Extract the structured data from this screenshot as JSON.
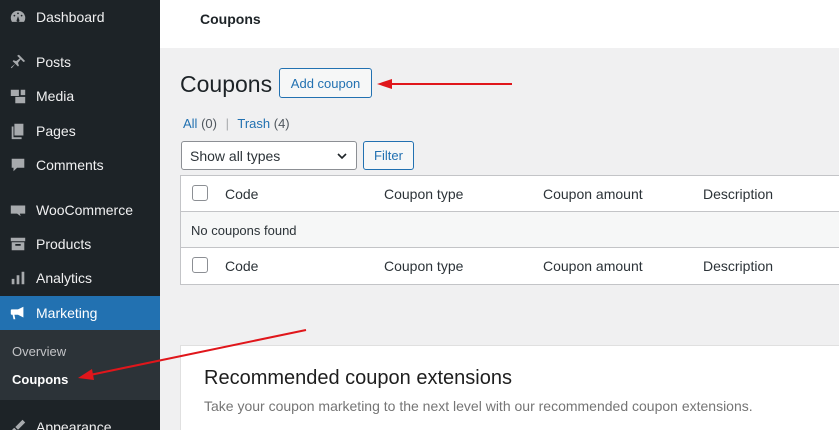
{
  "sidebar": {
    "items": [
      {
        "label": "Dashboard",
        "icon": "dashboard-icon"
      },
      {
        "label": "Posts",
        "icon": "pushpin-icon"
      },
      {
        "label": "Media",
        "icon": "media-icon"
      },
      {
        "label": "Pages",
        "icon": "pages-icon"
      },
      {
        "label": "Comments",
        "icon": "comment-icon"
      },
      {
        "label": "WooCommerce",
        "icon": "woocommerce-icon"
      },
      {
        "label": "Products",
        "icon": "archive-icon"
      },
      {
        "label": "Analytics",
        "icon": "bar-chart-icon"
      },
      {
        "label": "Marketing",
        "icon": "megaphone-icon"
      },
      {
        "label": "Appearance",
        "icon": "paintbrush-icon"
      }
    ],
    "submenu": [
      {
        "label": "Overview"
      },
      {
        "label": "Coupons"
      }
    ]
  },
  "header": {
    "title": "Coupons"
  },
  "main": {
    "title": "Coupons",
    "add_button": "Add coupon",
    "views": {
      "all_label": "All",
      "all_count": "(0)",
      "separator": "|",
      "trash_label": "Trash",
      "trash_count": "(4)"
    },
    "filter": {
      "select_value": "Show all types",
      "button": "Filter"
    },
    "table": {
      "columns": [
        "Code",
        "Coupon type",
        "Coupon amount",
        "Description"
      ],
      "empty_message": "No coupons found"
    },
    "recommended": {
      "title": "Recommended coupon extensions",
      "description": "Take your coupon marketing to the next level with our recommended coupon extensions."
    }
  },
  "colors": {
    "sidebar_bg": "#1d2327",
    "accent": "#2271b1",
    "annotation_arrow": "#e0161b"
  }
}
